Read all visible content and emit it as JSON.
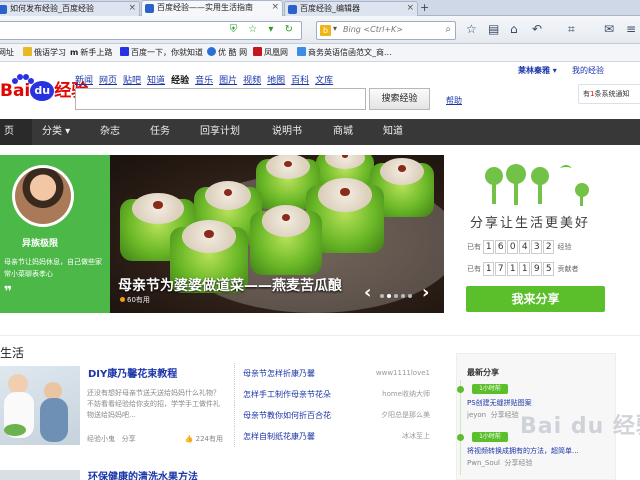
{
  "browser": {
    "tabs": [
      {
        "label": "如何发布经验_百度经验",
        "active": false
      },
      {
        "label": "百度经验——实用生活指南",
        "active": true
      },
      {
        "label": "百度经验_编辑器",
        "active": false
      }
    ],
    "new_tab": "+",
    "search_placeholder": "Bing <Ctrl+K>",
    "search_engine": "b"
  },
  "bookmarks": [
    {
      "label": "网址",
      "color": "#3b77d8"
    },
    {
      "label": "俄语学习",
      "color": "#e8b923"
    },
    {
      "label": "新手上路",
      "color": "#333333",
      "prefix": "m"
    },
    {
      "label": "百度一下，你就知道",
      "color": "#2932e1"
    },
    {
      "label": "优 酷 网",
      "color": "#2b6fd6"
    },
    {
      "label": "凤凰网",
      "color": "#c4161c"
    },
    {
      "label": "商务英语信函范文_商...",
      "color": "#3a8ee6"
    }
  ],
  "header": {
    "logo_bai": "Bai",
    "logo_du": "du",
    "logo_jingyan": "经验",
    "nav": [
      "新闻",
      "网页",
      "贴吧",
      "知道",
      "经验",
      "音乐",
      "图片",
      "视频",
      "地图",
      "百科",
      "文库"
    ],
    "nav_current": "经验",
    "search_button": "搜索经验",
    "help": "帮助",
    "user": "莱林秦雅 ▾",
    "my_exp": "我的经验",
    "msg_prefix": "有",
    "msg_count": "1",
    "msg_suffix": "条系统通知"
  },
  "menu": [
    "页",
    "分类 ▾",
    "杂志",
    "任务",
    "回享计划",
    "说明书",
    "商城",
    "知道"
  ],
  "banner": {
    "user_name": "异族极限",
    "quote": "母亲节让妈妈休息，自己做些家常小菜聊表孝心",
    "title": "母亲节为婆婆做道菜——燕麦苦瓜酿",
    "views": "60有用",
    "slide_count": 5,
    "slide_active": 1
  },
  "share": {
    "slogan": "分享让生活更美好",
    "exp_prefix": "已有",
    "exp_digits": [
      "1",
      "6",
      "0",
      "4",
      "3",
      "2"
    ],
    "exp_suffix": "经验",
    "user_prefix": "已有",
    "user_digits": [
      "1",
      "7",
      "1",
      "1",
      "9",
      "5"
    ],
    "user_suffix": "贡献者",
    "button": "我来分享"
  },
  "content": {
    "section_title": "生活",
    "featured": {
      "title": "DIY康乃馨花束教程",
      "desc": "还没有想好母亲节送天送给妈妈什么礼物？不妨看看经验给你支的招，学学手工做件礼物送给妈妈吧...",
      "author": "经验小鬼",
      "action": "分享",
      "useful": "224有用"
    },
    "links": [
      {
        "title": "母亲节怎样折康乃馨",
        "author": "www1111love1"
      },
      {
        "title": "怎样手工制作母亲节花朵",
        "author": "home收纳大师"
      },
      {
        "title": "母亲节教你如何折百合花",
        "author": "夕阳总是那么美"
      },
      {
        "title": "怎样自制纸花康乃馨",
        "author": "冰冰至上"
      }
    ],
    "latest": {
      "title": "最新分享",
      "items": [
        {
          "tag": "1小时前",
          "title": "PS创建无缝拼贴图案",
          "meta_user": "jeyon",
          "meta_action": "分享经验"
        },
        {
          "tag": "1小时前",
          "title": "将视频转换成拥有的方法，超简单...",
          "meta_user": "Pwn_Soul",
          "meta_action": "分享经验"
        }
      ]
    },
    "bottom_title": "环保健康的清洗水果方法",
    "watermark": "Bai du 经验"
  }
}
